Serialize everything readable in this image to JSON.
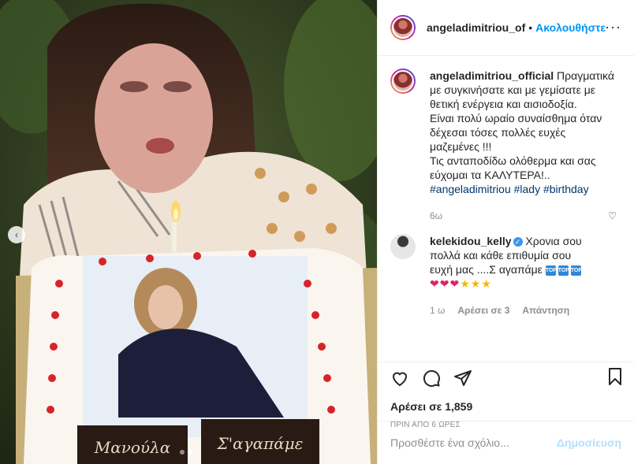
{
  "header": {
    "username": "angeladimitriou_of",
    "separator": "•",
    "follow_label": "Ακολουθήστε",
    "more_label": "···"
  },
  "caption": {
    "username": "angeladimitriou_official",
    "lines": [
      "Πραγματικά",
      "με συγκινήσατε και με γεμίσατε με",
      "θετική ενέργεια και αισιοδοξία.",
      "Είναι πολύ ωραίο συναίσθημα όταν",
      "δέχεσαι τόσες πολλές ευχές",
      "μαζεμένες !!!",
      "Τις ανταποδίδω ολόθερμα και σας",
      "εύχομαι τα ΚΑΛΥΤΕΡΑ!.."
    ],
    "hashtags": "#angeladimitriou #lady #birthday",
    "time": "6ω"
  },
  "comment": {
    "username": "kelekidou_kelly",
    "text_lines": [
      "Χρονια σου",
      "πολλά και κάθε επιθυμία σου",
      "ευχή μας ....Σ αγαπάμε"
    ],
    "top_label": "TOP",
    "time": "1 ω",
    "likes": "Αρέσει σε 3",
    "reply": "Απάντηση"
  },
  "actions": {
    "likes": "Αρέσει σε 1,859",
    "ago": "ΠΡΙΝ ΑΠΟ 6 ΩΡΕΣ"
  },
  "add_comment": {
    "placeholder": "Προσθέστε ένα σχόλιο...",
    "post_label": "Δημοσίευση"
  },
  "photo": {
    "cake_text_left": "Μανούλα",
    "cake_text_right": "Σ'αγαπάμε",
    "carousel_prev": "‹"
  },
  "colors": {
    "link_blue": "#0095f6",
    "hashtag": "#00376b",
    "muted": "#8e8e8e"
  }
}
